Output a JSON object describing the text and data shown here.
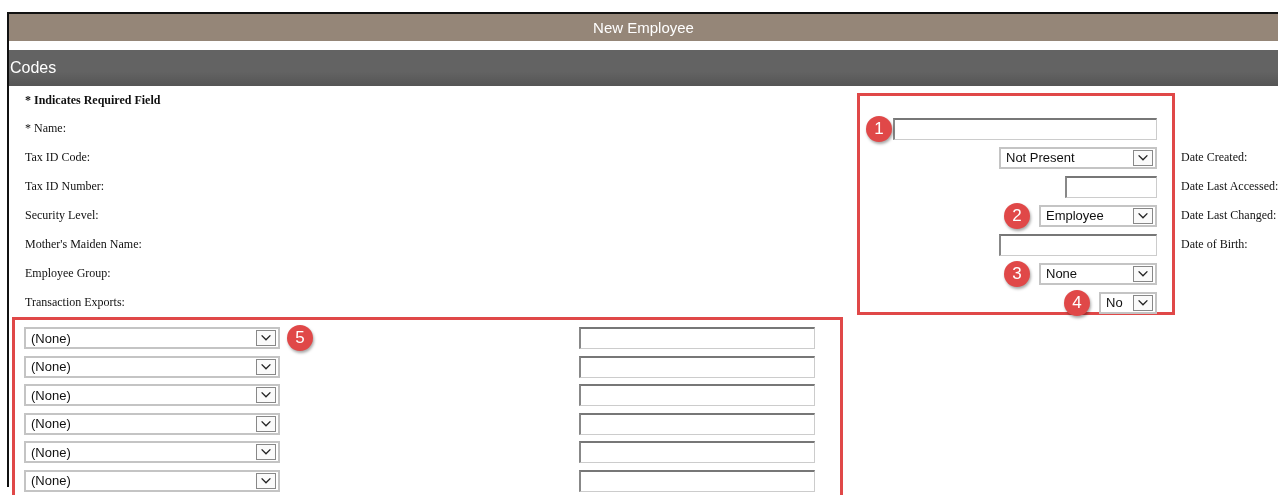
{
  "window": {
    "title": "New Employee"
  },
  "section": {
    "title": "Codes"
  },
  "required_note": "* Indicates Required Field",
  "fields": [
    {
      "label": "* Name:",
      "kind": "text",
      "callout": "1"
    },
    {
      "label": "Tax ID Code:",
      "kind": "select",
      "value": "Not Present"
    },
    {
      "label": "Tax ID Number:",
      "kind": "text"
    },
    {
      "label": "Security Level:",
      "kind": "select",
      "value": "Employee",
      "callout": "2"
    },
    {
      "label": "Mother's Maiden Name:",
      "kind": "text"
    },
    {
      "label": "Employee Group:",
      "kind": "select",
      "value": "None",
      "callout": "3"
    },
    {
      "label": "Transaction Exports:",
      "kind": "select",
      "value": "No",
      "callout": "4"
    }
  ],
  "date_labels": [
    "Date Created:",
    "Date Last Accessed:",
    "Date Last Changed:",
    "Date of Birth:"
  ],
  "export_rows": [
    {
      "value": "(None)",
      "callout": "5"
    },
    {
      "value": "(None)"
    },
    {
      "value": "(None)"
    },
    {
      "value": "(None)"
    },
    {
      "value": "(None)"
    },
    {
      "value": "(None)"
    }
  ]
}
